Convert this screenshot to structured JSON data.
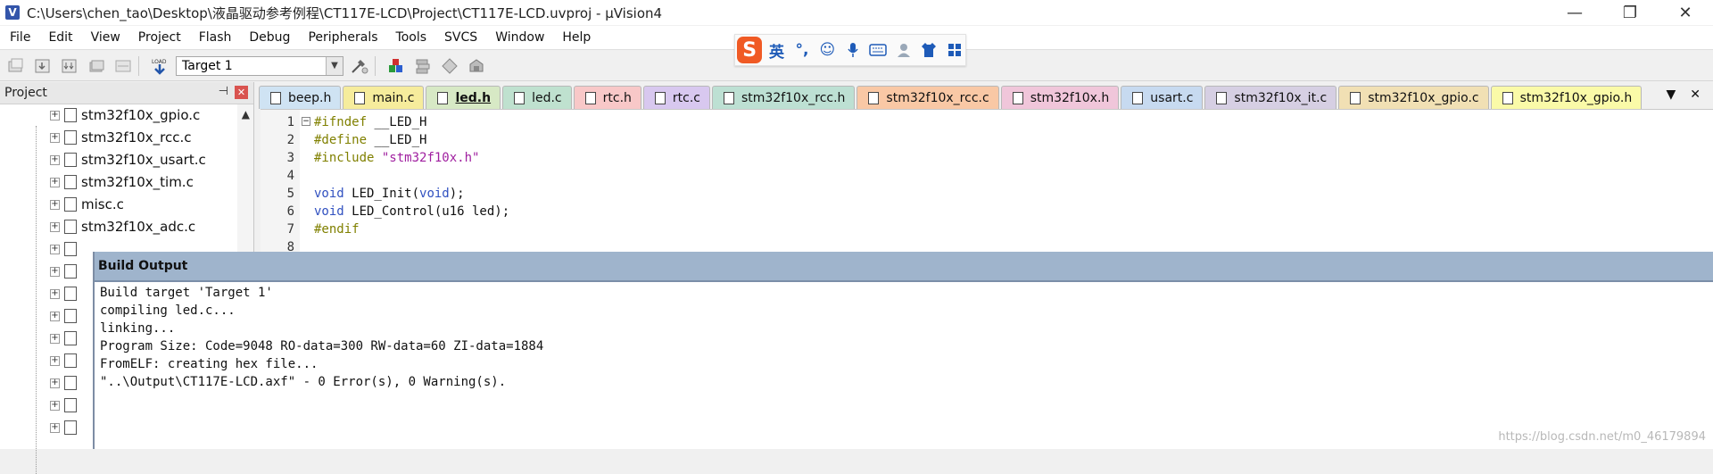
{
  "window": {
    "icon_letter": "V",
    "title": "C:\\Users\\chen_tao\\Desktop\\液晶驱动参考例程\\CT117E-LCD\\Project\\CT117E-LCD.uvproj - µVision4",
    "minimize": "—",
    "maximize": "❐",
    "close": "✕"
  },
  "menu": [
    "File",
    "Edit",
    "View",
    "Project",
    "Flash",
    "Debug",
    "Peripherals",
    "Tools",
    "SVCS",
    "Window",
    "Help"
  ],
  "toolbar": {
    "target": "Target 1",
    "load_label": "LOAD"
  },
  "ime": {
    "logo": "S",
    "lang": "英",
    "items": [
      "punct-icon",
      "emoji-icon",
      "mic-icon",
      "keyboard-icon",
      "user-icon",
      "shirt-icon",
      "grid-icon"
    ],
    "glyphs": [
      "°,",
      "☺",
      "🎤",
      "⌨",
      "👤",
      "👕",
      "▦"
    ]
  },
  "project_panel": {
    "title": "Project",
    "pin": "⊣",
    "close": "✕",
    "files": [
      "stm32f10x_gpio.c",
      "stm32f10x_rcc.c",
      "stm32f10x_usart.c",
      "stm32f10x_tim.c",
      "misc.c",
      "stm32f10x_adc.c"
    ],
    "hidden_rows": 9
  },
  "tabs": [
    {
      "label": "beep.h",
      "color": "#cfe3f3"
    },
    {
      "label": "main.c",
      "color": "#f6ec9c"
    },
    {
      "label": "led.h",
      "color": "#d7e9c5",
      "active": true
    },
    {
      "label": "led.c",
      "color": "#bfe1cf"
    },
    {
      "label": "rtc.h",
      "color": "#f8c8c8"
    },
    {
      "label": "rtc.c",
      "color": "#d8c8ef"
    },
    {
      "label": "stm32f10x_rcc.h",
      "color": "#bde0d3"
    },
    {
      "label": "stm32f10x_rcc.c",
      "color": "#f9c8a5"
    },
    {
      "label": "stm32f10x.h",
      "color": "#f0c6da"
    },
    {
      "label": "usart.c",
      "color": "#c7daf0"
    },
    {
      "label": "stm32f10x_it.c",
      "color": "#d6cfe3"
    },
    {
      "label": "stm32f10x_gpio.c",
      "color": "#f1e0b4"
    },
    {
      "label": "stm32f10x_gpio.h",
      "color": "#fafaa8"
    }
  ],
  "tab_controls": {
    "dropdown": "▼",
    "close": "✕"
  },
  "editor": {
    "line_numbers": [
      "1",
      "2",
      "3",
      "4",
      "5",
      "6",
      "7",
      "8"
    ],
    "lines": [
      {
        "a": "#ifndef",
        "b": " __LED_H",
        "c": ""
      },
      {
        "a": "#define",
        "b": " __LED_H",
        "c": ""
      },
      {
        "a": "#include",
        "b": " ",
        "c": "\"stm32f10x.h\""
      },
      {
        "a": "",
        "b": "",
        "c": ""
      },
      {
        "a": "void",
        "b": " LED_Init(",
        "c": "void",
        "d": ");"
      },
      {
        "a": "void",
        "b": " LED_Control(u16 led);",
        "c": ""
      },
      {
        "a": "#endif",
        "b": "",
        "c": ""
      }
    ]
  },
  "build_output": {
    "title": "Build Output",
    "lines": [
      "Build target 'Target 1'",
      "compiling led.c...",
      "linking...",
      "Program Size: Code=9048 RO-data=300 RW-data=60 ZI-data=1884",
      "FromELF: creating hex file...",
      "\"..\\Output\\CT117E-LCD.axf\" - 0 Error(s), 0 Warning(s)."
    ]
  },
  "watermark": "https://blog.csdn.net/m0_46179894"
}
